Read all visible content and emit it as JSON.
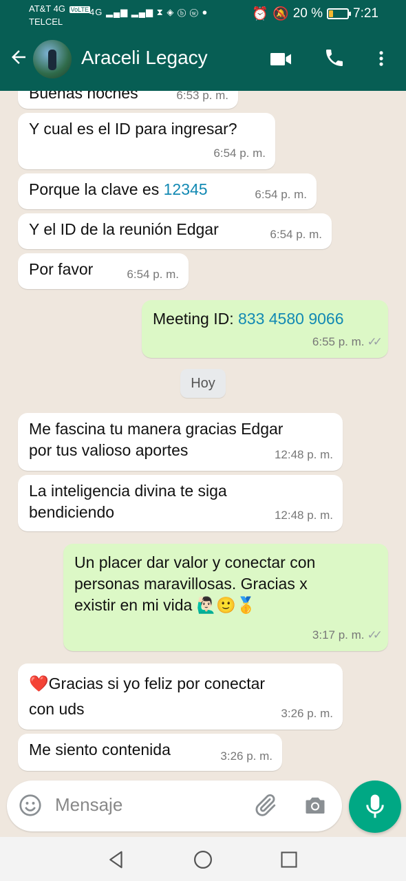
{
  "status_bar": {
    "carrier": "AT&T 4G",
    "carrier2": "TELCEL",
    "network_badge": "VoLTE",
    "signal_label": "4G",
    "battery": "20 %",
    "battery_level": 0.2,
    "time": "7:21"
  },
  "header": {
    "contact_name": "Araceli Legacy"
  },
  "messages": [
    {
      "dir": "in",
      "text": "Buenas noches",
      "time": "6:53 p. m."
    },
    {
      "dir": "in",
      "text": "Y cual es el ID para ingresar?",
      "time": "6:54 p. m."
    },
    {
      "dir": "in",
      "text_prefix": "Porque la clave es ",
      "link": "12345",
      "time": "6:54 p. m."
    },
    {
      "dir": "in",
      "text": "Y el ID de la reunión Edgar",
      "time": "6:54 p. m."
    },
    {
      "dir": "in",
      "text": "Por favor",
      "time": "6:54 p. m."
    },
    {
      "dir": "out",
      "text_prefix": "Meeting ID: ",
      "link": "833 4580 9066",
      "time": "6:55 p. m."
    },
    {
      "dir": "in",
      "text_line1": "Me fascina tu manera gracias Edgar",
      "text_line2": "por tus valioso aportes",
      "time": "12:48 p. m."
    },
    {
      "dir": "in",
      "text_line1": "La inteligencia divina te siga",
      "text_line2": "bendiciendo",
      "time": "12:48 p. m."
    },
    {
      "dir": "out",
      "text_line1": "Un placer dar valor y conectar con",
      "text_line2": "personas maravillosas. Gracias x",
      "text_line3": "existir en mi vida",
      "emojis": "🙋🏻‍♂️🙂🥇",
      "time": "3:17 p. m."
    },
    {
      "dir": "in",
      "heart": "❤️",
      "text_line1": "Gracias si yo feliz por conectar",
      "text_line2": "con uds",
      "time": "3:26 p. m."
    },
    {
      "dir": "in",
      "text": "Me siento contenida",
      "time": "3:26 p. m."
    }
  ],
  "day_separator": "Hoy",
  "input": {
    "placeholder": "Mensaje"
  },
  "icons": [
    "back-arrow-icon",
    "avatar",
    "video-call-icon",
    "phone-icon",
    "more-vert-icon",
    "emoji-icon",
    "attach-icon",
    "camera-icon",
    "mic-icon",
    "nav-back-icon",
    "nav-home-icon",
    "nav-recents-icon",
    "double-check-icon"
  ],
  "colors": {
    "header": "#075e54",
    "incoming": "#ffffff",
    "outgoing": "#dcf8c6",
    "link": "#1289b3",
    "mic": "#00a884",
    "background": "#efe7de"
  }
}
